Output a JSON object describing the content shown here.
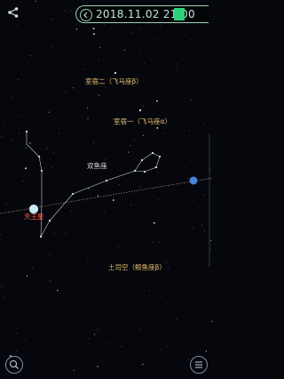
{
  "top": {
    "datetime": "2018.11.02  21:00",
    "share_icon": "share-icon",
    "time_icon": "chevron-left-icon"
  },
  "labels": {
    "star_1": "室宿二（飞马座β）",
    "star_2": "室宿一（飞马座α）",
    "constellation": "双鱼座",
    "planet": "天王星",
    "star_3": "土司空（鲸鱼座β）"
  },
  "bottom": {
    "search_icon": "search-icon",
    "menu_icon": "menu-icon"
  },
  "colors": {
    "background": "#05070c",
    "star_label": "#e8c070",
    "planet_label": "#ff5a45",
    "accent": "#2fd07c"
  }
}
